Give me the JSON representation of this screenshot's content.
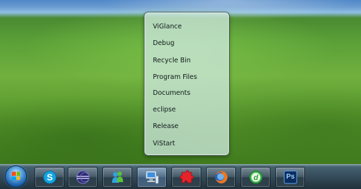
{
  "jumplist": {
    "items": [
      {
        "label": "ViGlance"
      },
      {
        "label": "Debug"
      },
      {
        "label": "Recycle Bin"
      },
      {
        "label": "Program Files"
      },
      {
        "label": "Documents"
      },
      {
        "label": "eclipse"
      },
      {
        "label": "Release"
      },
      {
        "label": "ViStart"
      }
    ]
  },
  "taskbar": {
    "start": {
      "icon": "windows-start-icon"
    },
    "buttons": [
      {
        "icon": "skype-icon"
      },
      {
        "icon": "eclipse-icon"
      },
      {
        "icon": "messenger-icon"
      },
      {
        "icon": "computer-icon"
      },
      {
        "icon": "puzzle-icon"
      },
      {
        "icon": "firefox-icon"
      },
      {
        "icon": "dreamweaver-icon"
      },
      {
        "label": "Ps",
        "icon": "photoshop-icon"
      }
    ]
  },
  "colors": {
    "jumplist_bg": "#cde8dc",
    "taskbar_bg": "#1e2d3c",
    "grass": "#5aa037",
    "sky": "#4f87c7"
  }
}
